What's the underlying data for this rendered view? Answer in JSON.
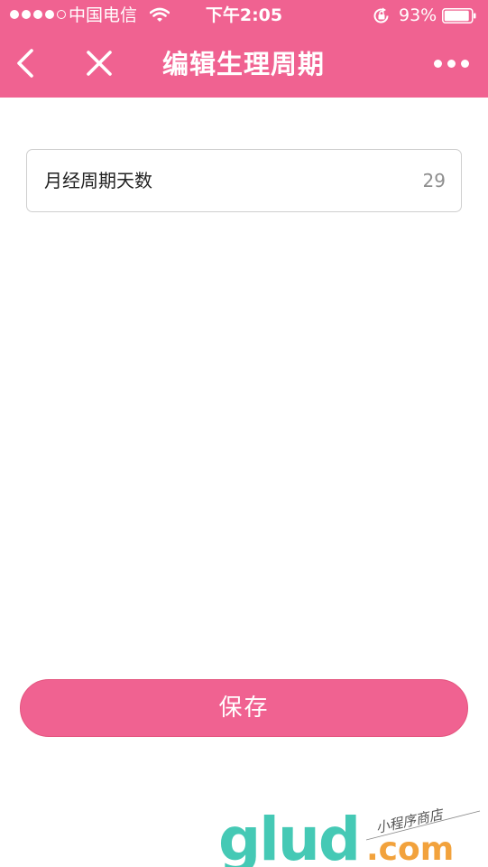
{
  "status_bar": {
    "carrier": "中国电信",
    "time": "下午2:05",
    "battery": "93%",
    "battery_level": 0.93
  },
  "nav": {
    "title": "编辑生理周期",
    "back_icon": "chevron-left-icon",
    "close_icon": "close-icon",
    "more_icon": "more-dots-icon"
  },
  "form": {
    "cycle_days": {
      "label": "月经周期天数",
      "value": "29"
    }
  },
  "actions": {
    "save_label": "保存"
  },
  "watermark": {
    "brand": "glud.com",
    "tagline": "小程序商店"
  },
  "colors": {
    "accent": "#f06291",
    "watermark_teal": "#45c9b5",
    "watermark_orange": "#f2a23c"
  }
}
